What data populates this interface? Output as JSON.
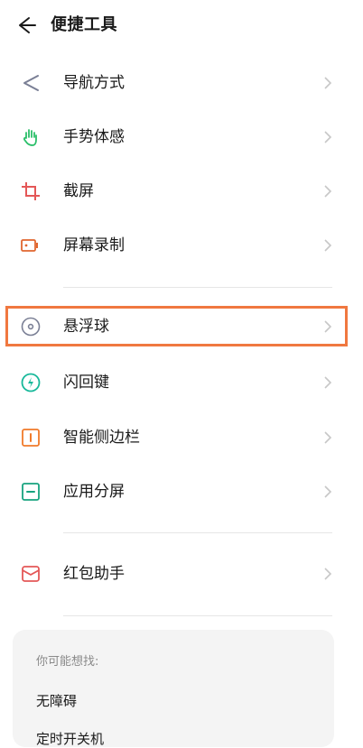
{
  "header": {
    "title": "便捷工具",
    "back_icon": "arrow-left-icon"
  },
  "items": [
    {
      "label": "导航方式",
      "icon": "navigation-icon",
      "color": "#7a7f95"
    },
    {
      "label": "手势体感",
      "icon": "hand-icon",
      "color": "#2bbf6a"
    },
    {
      "label": "截屏",
      "icon": "crop-icon",
      "color": "#e45757"
    },
    {
      "label": "屏幕录制",
      "icon": "screen-record-icon",
      "color": "#e0662f"
    },
    {
      "label": "悬浮球",
      "icon": "floating-ball-icon",
      "color": "#7a7f95"
    },
    {
      "label": "闪回键",
      "icon": "flashback-icon",
      "color": "#17b89a"
    },
    {
      "label": "智能侧边栏",
      "icon": "sidebar-icon",
      "color": "#f07a2a"
    },
    {
      "label": "应用分屏",
      "icon": "split-screen-icon",
      "color": "#17a37f"
    },
    {
      "label": "红包助手",
      "icon": "red-envelope-icon",
      "color": "#e45757"
    }
  ],
  "suggest": {
    "heading": "你可能想找:",
    "links": [
      "无障碍",
      "定时开关机"
    ]
  },
  "colors": {
    "highlight": "#f07840",
    "chevron": "#c7c7c7"
  }
}
